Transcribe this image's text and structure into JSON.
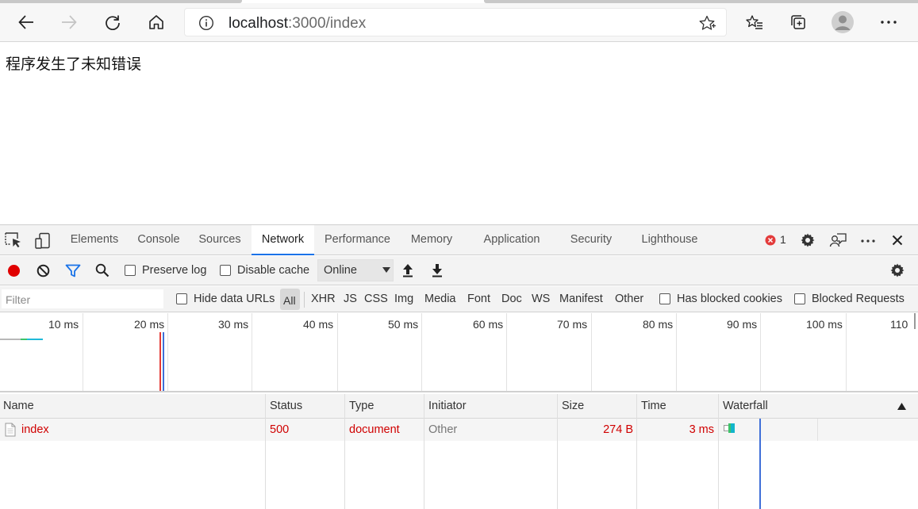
{
  "browser": {
    "url_host": "localhost",
    "url_path": ":3000/index"
  },
  "page": {
    "message": "程序发生了未知错误"
  },
  "devtools": {
    "tabs": [
      {
        "label": "Elements"
      },
      {
        "label": "Console"
      },
      {
        "label": "Sources"
      },
      {
        "label": "Network",
        "active": true
      },
      {
        "label": "Performance"
      },
      {
        "label": "Memory"
      },
      {
        "label": "Application"
      },
      {
        "label": "Security"
      },
      {
        "label": "Lighthouse"
      }
    ],
    "error_count": "1",
    "toolbar": {
      "preserve_log": "Preserve log",
      "disable_cache": "Disable cache",
      "throttle": "Online"
    },
    "filter": {
      "placeholder": "Filter",
      "hide_data_urls": "Hide data URLs",
      "types": [
        "All",
        "XHR",
        "JS",
        "CSS",
        "Img",
        "Media",
        "Font",
        "Doc",
        "WS",
        "Manifest",
        "Other"
      ],
      "has_blocked_cookies": "Has blocked cookies",
      "blocked_requests": "Blocked Requests"
    },
    "overview_ticks": [
      "10 ms",
      "20 ms",
      "30 ms",
      "40 ms",
      "50 ms",
      "60 ms",
      "70 ms",
      "80 ms",
      "90 ms",
      "100 ms",
      "110"
    ],
    "columns": [
      "Name",
      "Status",
      "Type",
      "Initiator",
      "Size",
      "Time",
      "Waterfall"
    ],
    "requests": [
      {
        "name": "index",
        "status": "500",
        "type": "document",
        "initiator": "Other",
        "size": "274 B",
        "time": "3 ms"
      }
    ],
    "colors": {
      "accent": "#1a73e8",
      "error": "#d00000",
      "record": "#e00000"
    }
  }
}
